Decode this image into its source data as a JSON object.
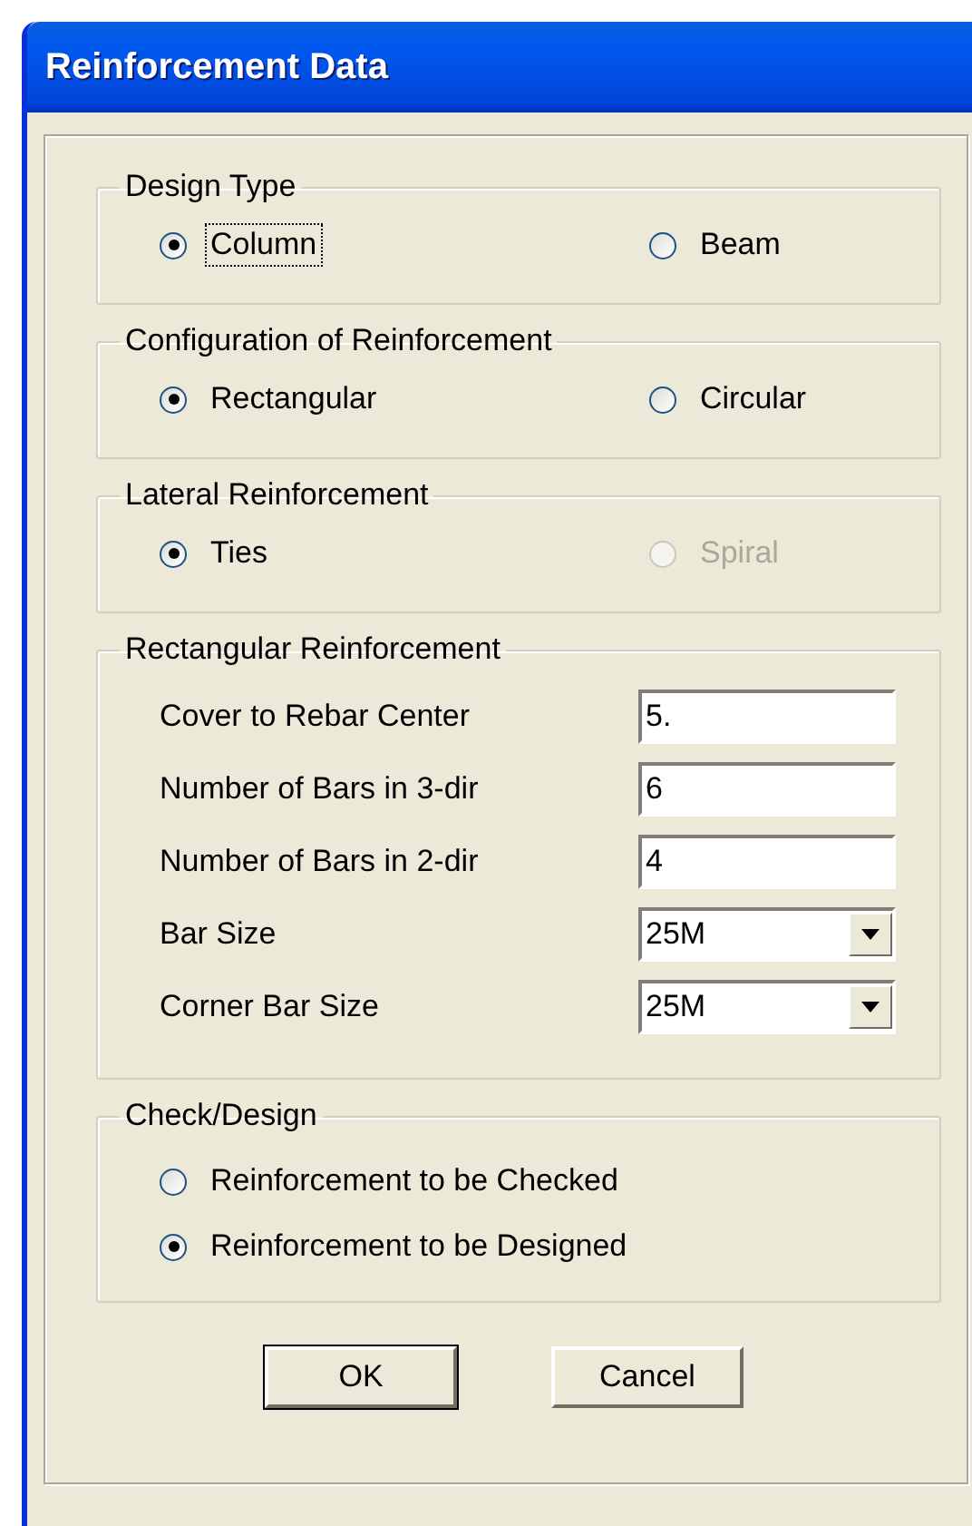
{
  "window": {
    "title": "Reinforcement Data"
  },
  "groups": [
    {
      "kind": "radio-row",
      "title": "Design Type",
      "options": [
        {
          "label": "Column",
          "selected": true,
          "disabled": false,
          "focused": true
        },
        {
          "label": "Beam",
          "selected": false,
          "disabled": false,
          "focused": false
        }
      ]
    },
    {
      "kind": "radio-row",
      "title": "Configuration of Reinforcement",
      "options": [
        {
          "label": "Rectangular",
          "selected": true,
          "disabled": false,
          "focused": false
        },
        {
          "label": "Circular",
          "selected": false,
          "disabled": false,
          "focused": false
        }
      ]
    },
    {
      "kind": "radio-row",
      "title": "Lateral Reinforcement",
      "options": [
        {
          "label": "Ties",
          "selected": true,
          "disabled": false,
          "focused": false
        },
        {
          "label": "Spiral",
          "selected": false,
          "disabled": true,
          "focused": false
        }
      ]
    },
    {
      "kind": "fields",
      "title": "Rectangular Reinforcement",
      "fields": [
        {
          "kind": "text",
          "label": "Cover to Rebar Center",
          "value": "5."
        },
        {
          "kind": "text",
          "label": "Number of Bars in 3-dir",
          "value": "6"
        },
        {
          "kind": "text",
          "label": "Number of Bars in 2-dir",
          "value": "4"
        },
        {
          "kind": "dropdown",
          "label": "Bar Size",
          "value": "25M"
        },
        {
          "kind": "dropdown",
          "label": "Corner Bar Size",
          "value": "25M"
        }
      ]
    },
    {
      "kind": "radio-list",
      "title": "Check/Design",
      "options": [
        {
          "label": "Reinforcement to be Checked",
          "selected": false,
          "disabled": false,
          "focused": false
        },
        {
          "label": "Reinforcement to be Designed",
          "selected": true,
          "disabled": false,
          "focused": false
        }
      ]
    }
  ],
  "buttons": [
    {
      "label": "OK",
      "default": true
    },
    {
      "label": "Cancel",
      "default": false
    }
  ]
}
